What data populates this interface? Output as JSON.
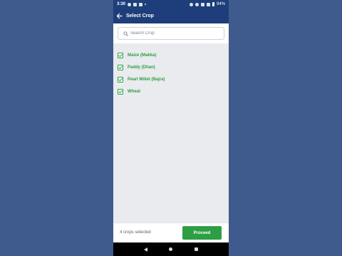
{
  "status_bar": {
    "time": "3:30",
    "battery": "94%",
    "left_icons": [
      "sync-icon",
      "message-icon",
      "gallery-icon",
      "dot-icon"
    ],
    "right_icons": [
      "location-icon",
      "eye-icon",
      "signal-lte-icon",
      "wifi-icon",
      "battery-icon"
    ]
  },
  "app_bar": {
    "title": "Select Crop",
    "back_icon": "arrow-left-icon"
  },
  "search": {
    "placeholder": "Search Crop",
    "value": "",
    "icon": "search-icon"
  },
  "crops": [
    {
      "label": "Maize (Makka)",
      "checked": true
    },
    {
      "label": "Paddy (Dhan)",
      "checked": true
    },
    {
      "label": "Pearl Millet (Bajra)",
      "checked": true
    },
    {
      "label": "Wheat",
      "checked": true
    }
  ],
  "footer": {
    "selected_count_text": "4 crops selected",
    "proceed_label": "Proceed"
  },
  "colors": {
    "primary": "#1d3e7a",
    "accent_green": "#2e9e44",
    "backdrop": "#3f5b8d"
  },
  "nav_bar": {
    "icons": [
      "back-nav-icon",
      "home-nav-icon",
      "recents-nav-icon"
    ]
  }
}
